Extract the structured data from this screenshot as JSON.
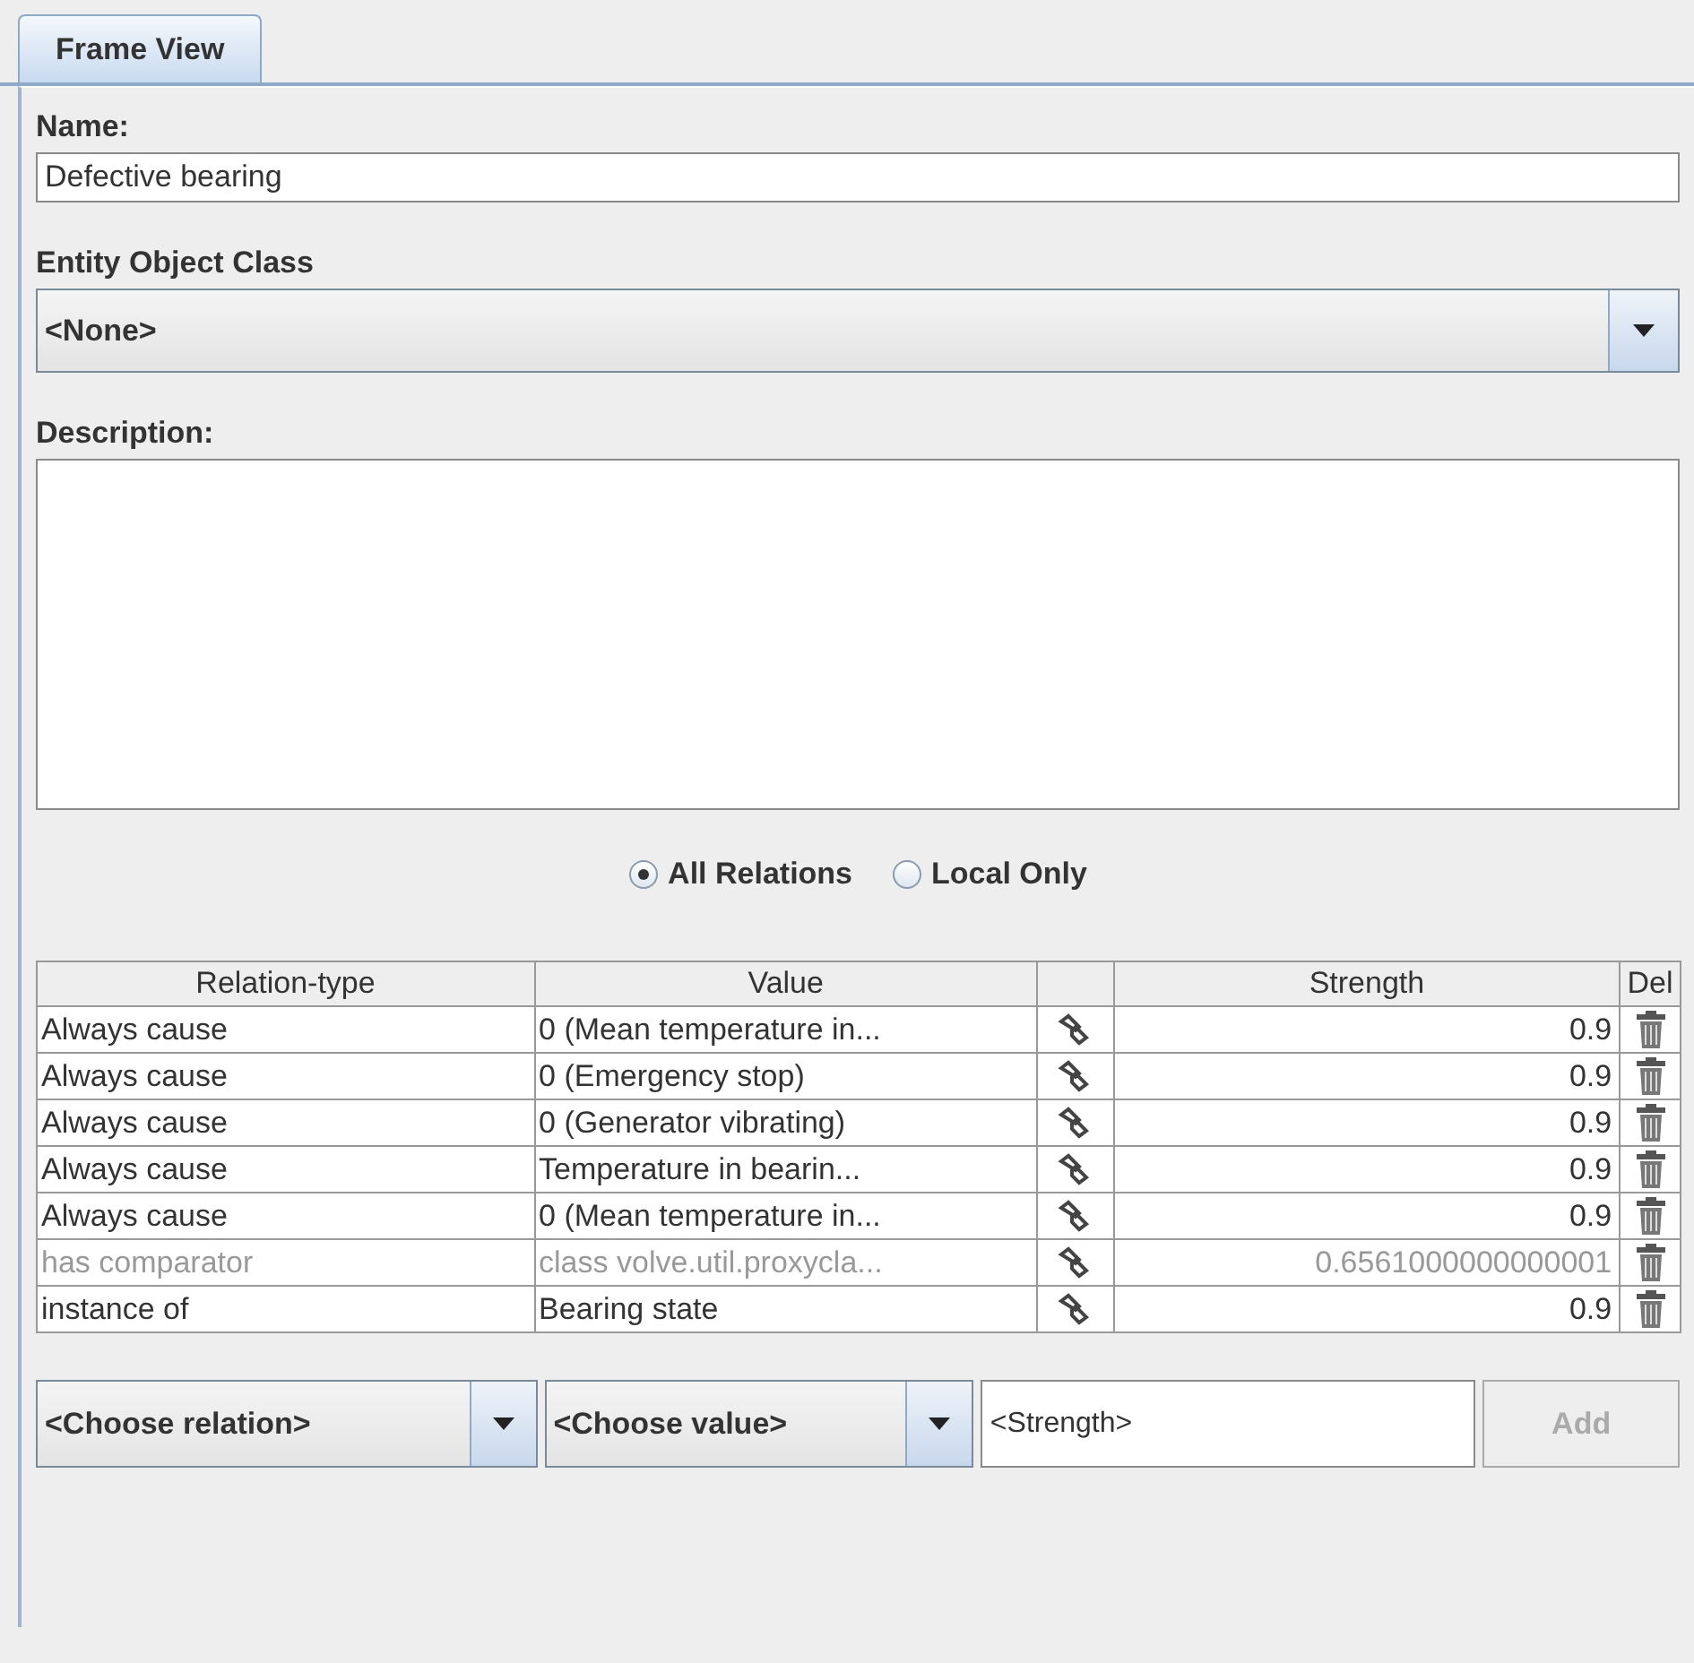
{
  "tabs": [
    {
      "label": "Frame View",
      "selected": true
    }
  ],
  "name": {
    "label": "Name:",
    "value": "Defective bearing"
  },
  "entity_class": {
    "label": "Entity Object Class",
    "value": "<None>"
  },
  "description": {
    "label": "Description:"
  },
  "scope": [
    {
      "label": "All Relations",
      "selected": true
    },
    {
      "label": "Local Only",
      "selected": false
    }
  ],
  "table": {
    "columns": [
      "Relation-type",
      "Value",
      "",
      "Strength",
      "Del"
    ],
    "rows": [
      {
        "relation": "Always cause",
        "value": "0 (Mean temperature in...",
        "strength": "0.9",
        "disabled": false
      },
      {
        "relation": "Always cause",
        "value": "0 (Emergency stop)",
        "strength": "0.9",
        "disabled": false
      },
      {
        "relation": "Always cause",
        "value": "0 (Generator vibrating)",
        "strength": "0.9",
        "disabled": false
      },
      {
        "relation": "Always cause",
        "value": "Temperature in bearin...",
        "strength": "0.9",
        "disabled": false
      },
      {
        "relation": "Always cause",
        "value": "0 (Mean temperature in...",
        "strength": "0.9",
        "disabled": false
      },
      {
        "relation": "has comparator",
        "value": "class volve.util.proxycla...",
        "strength": "0.6561000000000001",
        "disabled": true
      },
      {
        "relation": "instance of",
        "value": "Bearing state",
        "strength": "0.9",
        "disabled": false
      }
    ]
  },
  "add_bar": {
    "relation": "<Choose relation>",
    "value": "<Choose value>",
    "strength_placeholder": "<Strength>",
    "button": {
      "label": "Add",
      "disabled": true
    }
  }
}
